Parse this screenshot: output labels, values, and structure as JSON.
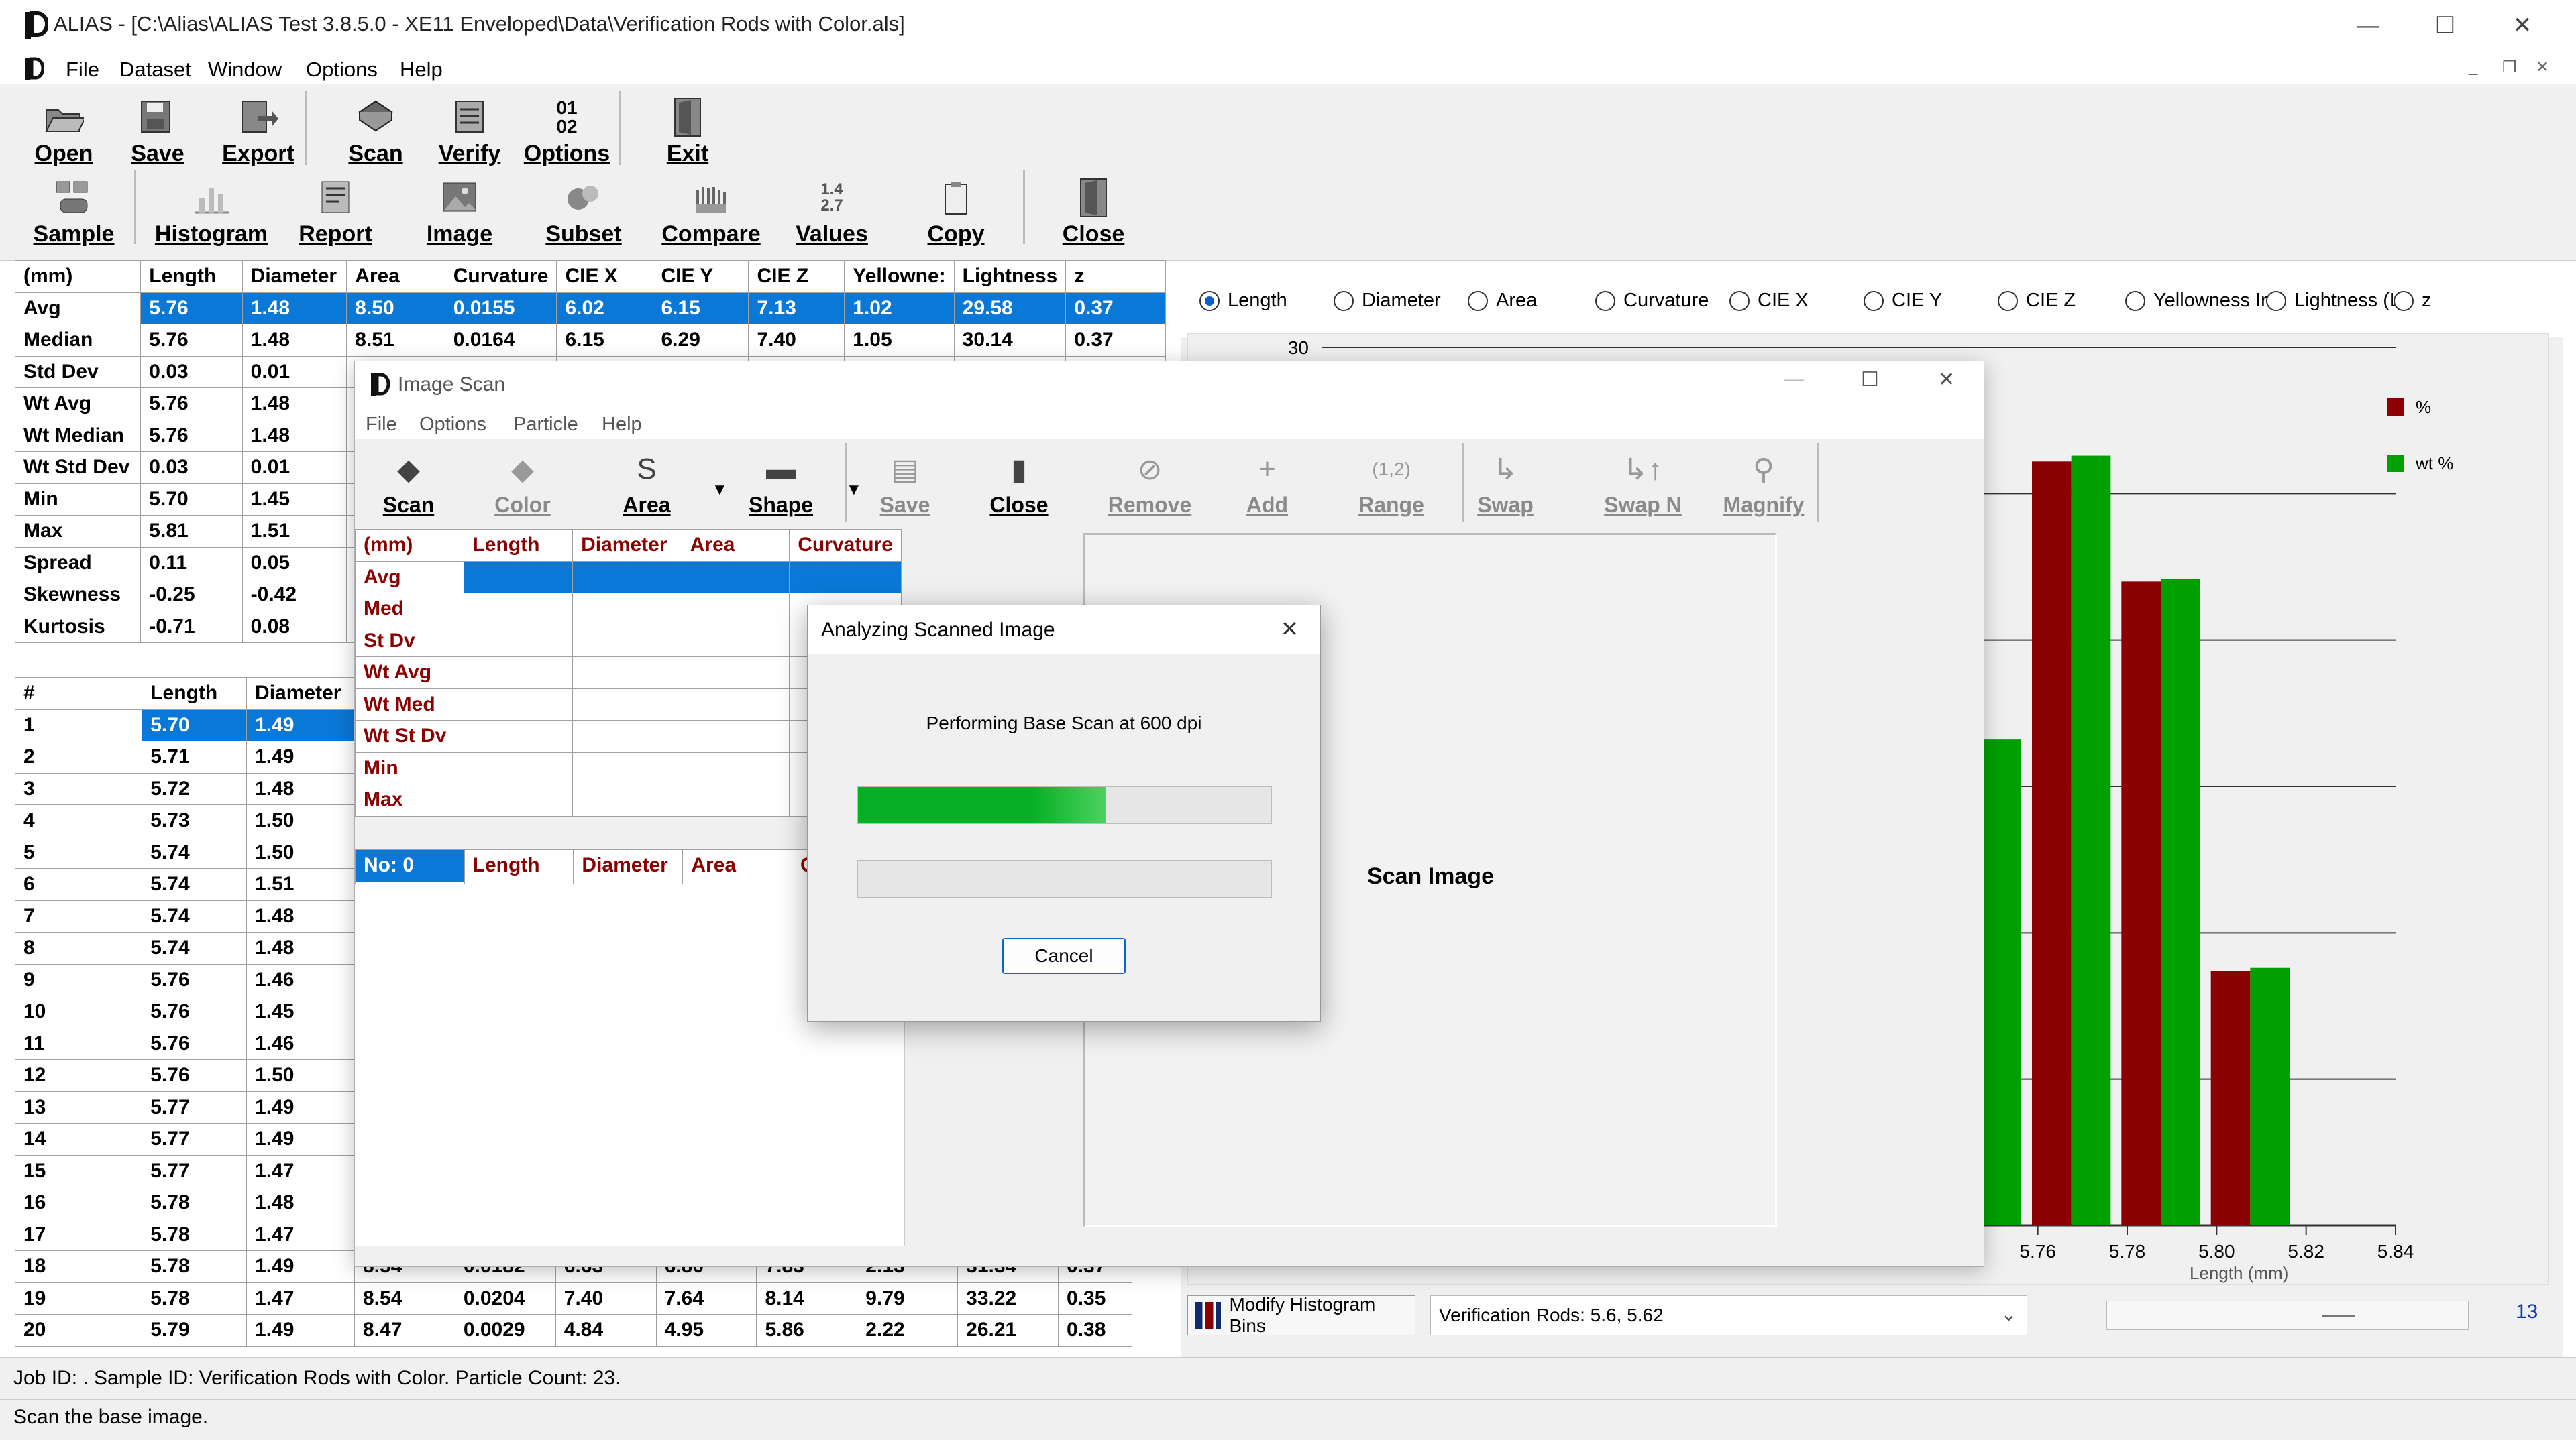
{
  "app": {
    "title": "ALIAS - [C:\\Alias\\ALIAS Test 3.8.5.0 - XE11 Enveloped\\Data\\Verification Rods with Color.als]"
  },
  "menu": [
    "File",
    "Dataset",
    "Window",
    "Options",
    "Help"
  ],
  "toolbar_row1": [
    "Open",
    "Save",
    "Export",
    "Scan",
    "Verify",
    "Options",
    "Exit"
  ],
  "toolbar_row2": [
    "Sample",
    "Histogram",
    "Report",
    "Image",
    "Subset",
    "Compare",
    "Values",
    "Copy",
    "Close"
  ],
  "stats": {
    "headers": [
      "(mm)",
      "Length",
      "Diameter",
      "Area",
      "Curvature",
      "CIE X",
      "CIE Y",
      "CIE Z",
      "Yellowne:",
      "Lightness",
      "z"
    ],
    "rows": [
      [
        "Avg",
        "5.76",
        "1.48",
        "8.50",
        "0.0155",
        "6.02",
        "6.15",
        "7.13",
        "1.02",
        "29.58",
        "0.37"
      ],
      [
        "Median",
        "5.76",
        "1.48",
        "8.51",
        "0.0164",
        "6.15",
        "6.29",
        "7.40",
        "1.05",
        "30.14",
        "0.37"
      ],
      [
        "Std Dev",
        "0.03",
        "0.01",
        "",
        "",
        "",
        "",
        "",
        "",
        "",
        ""
      ],
      [
        "Wt Avg",
        "5.76",
        "1.48",
        "",
        "",
        "",
        "",
        "",
        "",
        "",
        ""
      ],
      [
        "Wt Median",
        "5.76",
        "1.48",
        "",
        "",
        "",
        "",
        "",
        "",
        "",
        ""
      ],
      [
        "Wt Std Dev",
        "0.03",
        "0.01",
        "",
        "",
        "",
        "",
        "",
        "",
        "",
        ""
      ],
      [
        "Min",
        "5.70",
        "1.45",
        "",
        "",
        "",
        "",
        "",
        "",
        "",
        ""
      ],
      [
        "Max",
        "5.81",
        "1.51",
        "",
        "",
        "",
        "",
        "",
        "",
        "",
        ""
      ],
      [
        "Spread",
        "0.11",
        "0.05",
        "",
        "",
        "",
        "",
        "",
        "",
        "",
        ""
      ],
      [
        "Skewness",
        "-0.25",
        "-0.42",
        "",
        "",
        "",
        "",
        "",
        "",
        "",
        ""
      ],
      [
        "Kurtosis",
        "-0.71",
        "0.08",
        "",
        "",
        "",
        "",
        "",
        "",
        "",
        ""
      ]
    ]
  },
  "particles": {
    "headers": [
      "#",
      "Length",
      "Diameter"
    ],
    "rows": [
      [
        "1",
        "5.70",
        "1.49"
      ],
      [
        "2",
        "5.71",
        "1.49"
      ],
      [
        "3",
        "5.72",
        "1.48"
      ],
      [
        "4",
        "5.73",
        "1.50"
      ],
      [
        "5",
        "5.74",
        "1.50"
      ],
      [
        "6",
        "5.74",
        "1.51"
      ],
      [
        "7",
        "5.74",
        "1.48"
      ],
      [
        "8",
        "5.74",
        "1.48"
      ],
      [
        "9",
        "5.76",
        "1.46"
      ],
      [
        "10",
        "5.76",
        "1.45"
      ],
      [
        "11",
        "5.76",
        "1.46"
      ],
      [
        "12",
        "5.76",
        "1.50"
      ],
      [
        "13",
        "5.77",
        "1.49"
      ],
      [
        "14",
        "5.77",
        "1.49"
      ],
      [
        "15",
        "5.77",
        "1.47"
      ],
      [
        "16",
        "5.78",
        "1.48"
      ],
      [
        "17",
        "5.78",
        "1.47"
      ],
      [
        "18",
        "5.78",
        "1.49"
      ],
      [
        "19",
        "5.78",
        "1.47"
      ],
      [
        "20",
        "5.79",
        "1.49"
      ]
    ],
    "partial_rows": [
      [
        "8.54",
        "0.0182",
        "6.63",
        "6.80",
        "7.83",
        "2.13",
        "31.34",
        "0.37"
      ],
      [
        "8.54",
        "0.0204",
        "7.40",
        "7.64",
        "8.14",
        "9.79",
        "33.22",
        "0.35"
      ],
      [
        "8.47",
        "0.0029",
        "4.84",
        "4.95",
        "5.86",
        "2.22",
        "26.21",
        "0.38"
      ]
    ]
  },
  "radio_options": [
    "Length",
    "Diameter",
    "Area",
    "Curvature",
    "CIE X",
    "CIE Y",
    "CIE Z",
    "Yellowness Ir",
    "Lightness (L*",
    "z"
  ],
  "chart_data": {
    "type": "bar",
    "categories": [
      "5.76",
      "5.78",
      "5.80",
      "5.82"
    ],
    "series": [
      {
        "name": "%",
        "color": "#8b0000",
        "values": [
          26.1,
          22.0,
          8.7,
          null
        ],
        "hidden_left": 17.4
      },
      {
        "name": "wt %",
        "color": "#00a000",
        "values": [
          26.3,
          22.1,
          8.8,
          null
        ],
        "hidden_left": 16.6
      }
    ],
    "x_ticks": [
      "5.76",
      "5.78",
      "5.80",
      "5.82",
      "5.84"
    ],
    "y_tick_top": "30",
    "ylim": [
      0,
      30
    ],
    "xlabel": "Length (mm)",
    "legend": "top-right"
  },
  "bottom_panel": {
    "modify_bins": "Modify Histogram Bins",
    "dataset_select": "Verification Rods: 5.6, 5.62",
    "page_number": "13"
  },
  "status": {
    "line1": "Job ID: .  Sample ID: Verification Rods with Color.  Particle Count: 23.",
    "line2": "Scan the base image."
  },
  "scan_window": {
    "title": "Image Scan",
    "menu": [
      "File",
      "Options",
      "Particle",
      "Help"
    ],
    "toolbar": [
      "Scan",
      "Color",
      "Area",
      "Shape",
      "Save",
      "Close",
      "Remove",
      "Add",
      "Range",
      "Swap",
      "Swap N",
      "Magnify"
    ],
    "stats_headers": [
      "(mm)",
      "Length",
      "Diameter",
      "Area",
      "Curvature"
    ],
    "stats_rows": [
      "Avg",
      "Med",
      "St Dv",
      "Wt Avg",
      "Wt Med",
      "Wt St Dv",
      "Min",
      "Max"
    ],
    "particle_headers": [
      "No: 0",
      "Length",
      "Diameter",
      "Area",
      "C"
    ],
    "image_label": "Scan Image"
  },
  "dialog": {
    "title": "Analyzing Scanned Image",
    "message": "Performing Base Scan at 600 dpi",
    "progress1": 0.6,
    "progress2": 0.0,
    "cancel": "Cancel"
  }
}
